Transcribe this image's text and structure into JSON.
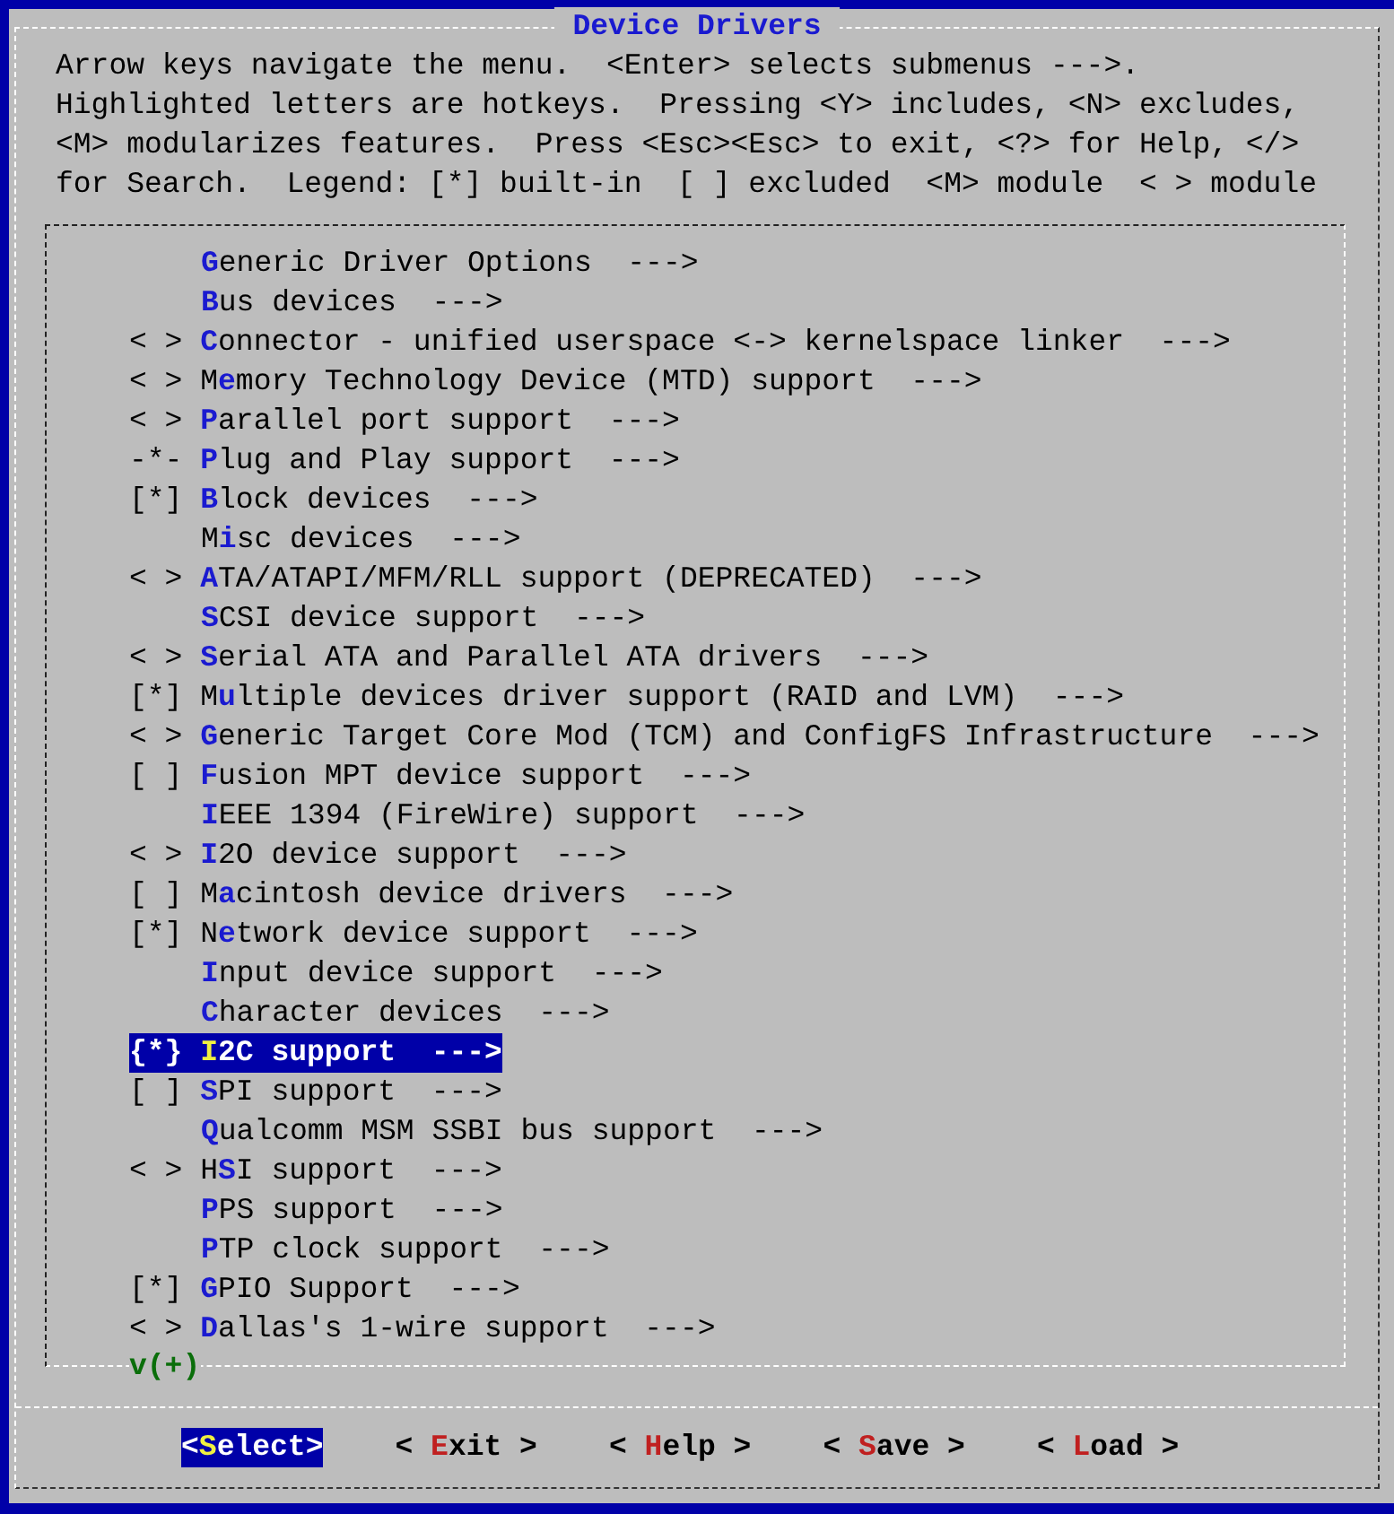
{
  "window": {
    "title": "Device Drivers"
  },
  "help_text": [
    "Arrow keys navigate the menu.  <Enter> selects submenus --->.",
    "Highlighted letters are hotkeys.  Pressing <Y> includes, <N> excludes,",
    "<M> modularizes features.  Press <Esc><Esc> to exit, <?> for Help, </>",
    "for Search.  Legend: [*] built-in  [ ] excluded  <M> module  < > module"
  ],
  "menu_items": [
    {
      "hotkey": "G",
      "after": "eneric Driver Options  --->",
      "selected": false
    },
    {
      "hotkey": "B",
      "after": "us devices  --->",
      "selected": false
    },
    {
      "prefix": "< >",
      "hotkey": "C",
      "after": "onnector - unified userspace <-> kernelspace linker  --->",
      "selected": false
    },
    {
      "prefix": "< >",
      "before": "M",
      "hotkey": "e",
      "after": "mory Technology Device (MTD) support  --->",
      "selected": false
    },
    {
      "prefix": "< >",
      "hotkey": "P",
      "after": "arallel port support  --->",
      "selected": false
    },
    {
      "prefix": "-*-",
      "hotkey": "P",
      "after": "lug and Play support  --->",
      "selected": false
    },
    {
      "prefix": "[*]",
      "hotkey": "B",
      "after": "lock devices  --->",
      "selected": false
    },
    {
      "before": "M",
      "hotkey": "i",
      "after": "sc devices  --->",
      "selected": false
    },
    {
      "prefix": "< >",
      "hotkey": "A",
      "after": "TA/ATAPI/MFM/RLL support (DEPRECATED)  --->",
      "selected": false
    },
    {
      "hotkey": "S",
      "after": "CSI device support  --->",
      "selected": false
    },
    {
      "prefix": "< >",
      "hotkey": "S",
      "after": "erial ATA and Parallel ATA drivers  --->",
      "selected": false
    },
    {
      "prefix": "[*]",
      "before": "M",
      "hotkey": "u",
      "after": "ltiple devices driver support (RAID and LVM)  --->",
      "selected": false
    },
    {
      "prefix": "< >",
      "hotkey": "G",
      "after": "eneric Target Core Mod (TCM) and ConfigFS Infrastructure  --->",
      "selected": false
    },
    {
      "prefix": "[ ]",
      "hotkey": "F",
      "after": "usion MPT device support  --->",
      "selected": false
    },
    {
      "hotkey": "I",
      "after": "EEE 1394 (FireWire) support  --->",
      "selected": false
    },
    {
      "prefix": "< >",
      "hotkey": "I",
      "after": "2O device support  --->",
      "selected": false
    },
    {
      "prefix": "[ ]",
      "before": "M",
      "hotkey": "a",
      "after": "cintosh device drivers  --->",
      "selected": false
    },
    {
      "prefix": "[*]",
      "before": "N",
      "hotkey": "e",
      "after": "twork device support  --->",
      "selected": false
    },
    {
      "hotkey": "I",
      "after": "nput device support  --->",
      "selected": false
    },
    {
      "hotkey": "C",
      "after": "haracter devices  --->",
      "selected": false
    },
    {
      "prefix": "{*}",
      "hotkey": "I",
      "after": "2C support  --->",
      "selected": true
    },
    {
      "prefix": "[ ]",
      "hotkey": "S",
      "after": "PI support  --->",
      "selected": false
    },
    {
      "hotkey": "Q",
      "after": "ualcomm MSM SSBI bus support  --->",
      "selected": false
    },
    {
      "prefix": "< >",
      "before": "H",
      "hotkey": "S",
      "after": "I support  --->",
      "selected": false
    },
    {
      "hotkey": "P",
      "after": "PS support  --->",
      "selected": false
    },
    {
      "hotkey": "P",
      "after": "TP clock support  --->",
      "selected": false
    },
    {
      "prefix": "[*]",
      "hotkey": "G",
      "after": "PIO Support  --->",
      "selected": false
    },
    {
      "prefix": "< >",
      "hotkey": "D",
      "after": "allas's 1-wire support  --->",
      "selected": false
    }
  ],
  "scroll_indicator": "v(+)",
  "buttons": [
    {
      "before": "<",
      "hotkey": "S",
      "after": "elect>",
      "selected": true
    },
    {
      "before": "< ",
      "hotkey": "E",
      "after": "xit >",
      "selected": false
    },
    {
      "before": "< ",
      "hotkey": "H",
      "after": "elp >",
      "selected": false
    },
    {
      "before": "< ",
      "hotkey": "S",
      "after": "ave >",
      "selected": false
    },
    {
      "before": "< ",
      "hotkey": "L",
      "after": "oad >",
      "selected": false
    }
  ]
}
